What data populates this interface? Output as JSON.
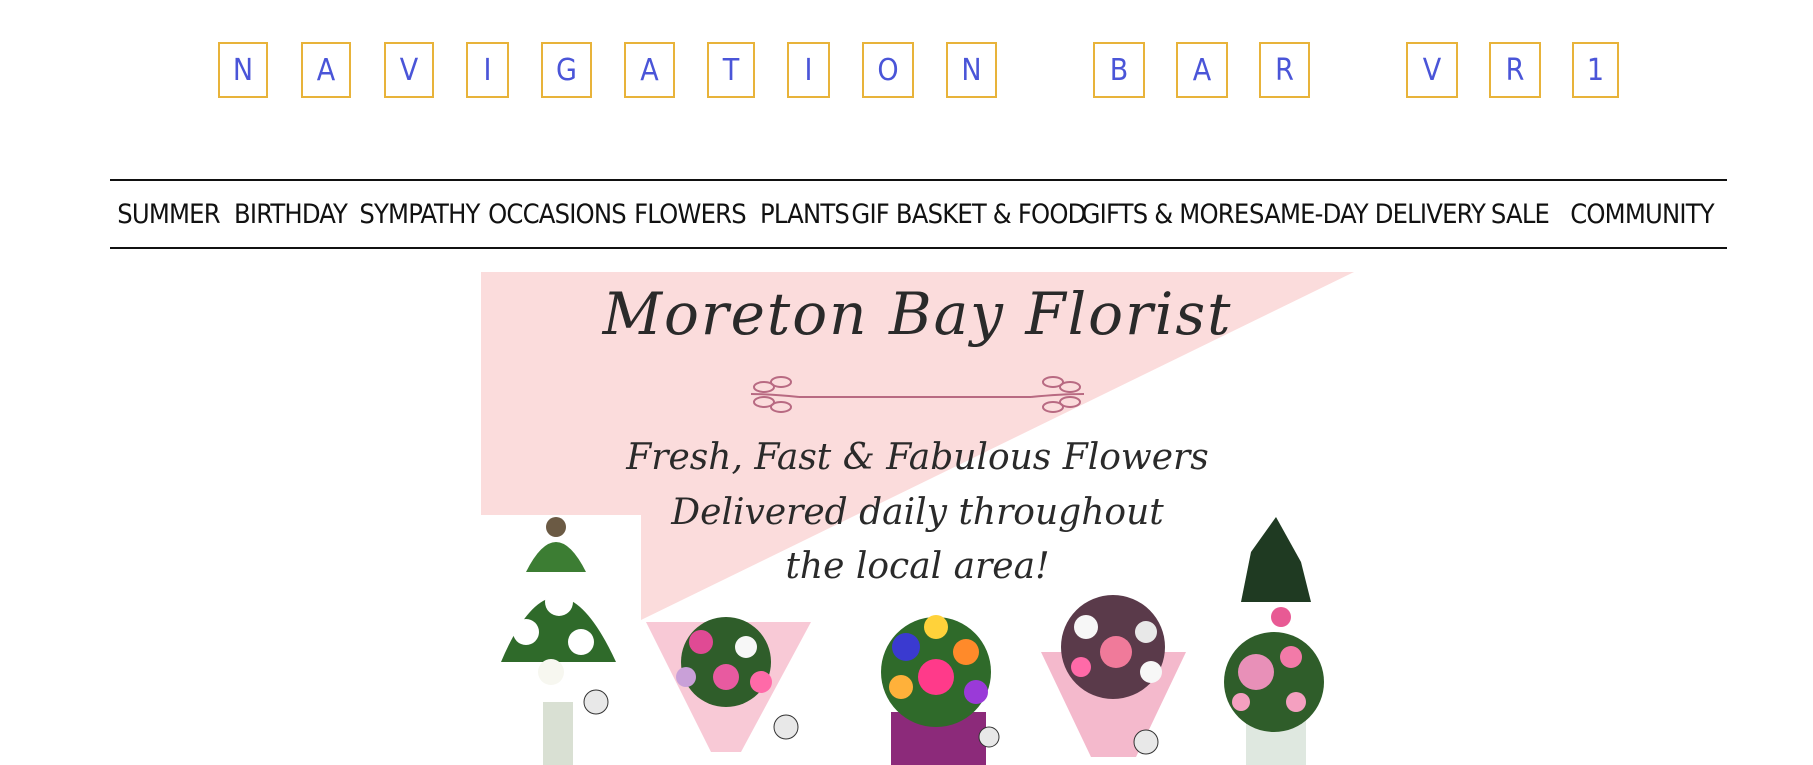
{
  "title_letters": [
    "N",
    "A",
    "V",
    "I",
    "G",
    "A",
    "T",
    "I",
    "O",
    "N",
    "B",
    "A",
    "R",
    "V",
    "R",
    "1"
  ],
  "nav": {
    "items": [
      "SUMMER",
      "BIRTHDAY",
      "SYMPATHY",
      "OCCASIONS",
      "FLOWERS",
      "PLANTS",
      "GIF BASKET & FOOD",
      "GIFTS & MORE",
      "SAME-DAY DELIVERY",
      "SALE",
      "COMMUNITY"
    ]
  },
  "banner": {
    "title": "Moreton Bay Florist",
    "tagline_1": "Fresh, Fast & Fabulous Flowers",
    "tagline_2": "Delivered daily throughout",
    "tagline_3": "the local area!"
  },
  "colors": {
    "letter_text": "#4a55d8",
    "letter_border": "#e8b33a",
    "banner_pink": "#fbdcdc"
  }
}
